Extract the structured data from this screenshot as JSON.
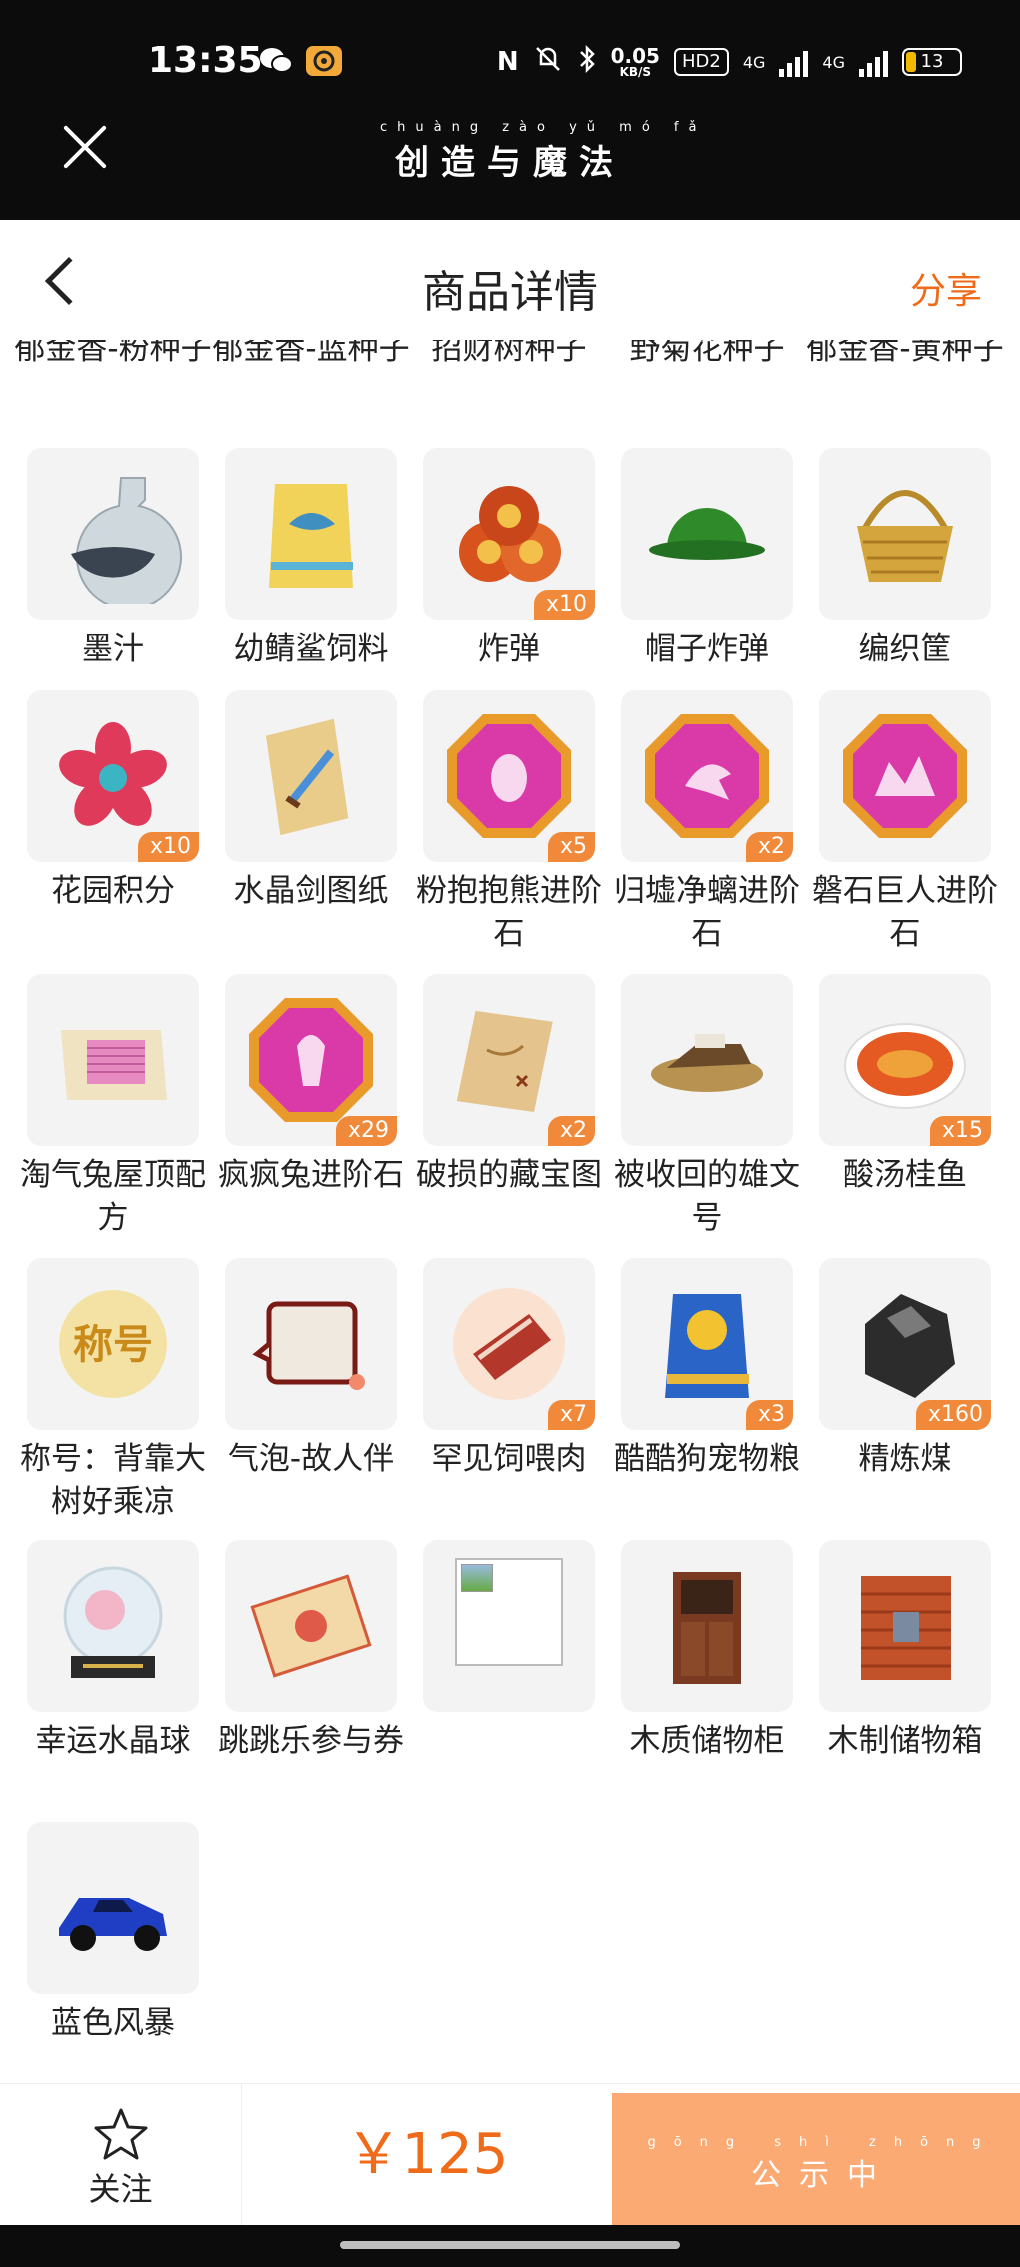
{
  "status_bar": {
    "time": "13:35",
    "speed_value": "0.05",
    "speed_unit": "KB/S",
    "hd": "HD2",
    "net1": "4G",
    "net2": "4G",
    "battery": "13"
  },
  "app": {
    "title": "创造与魔法",
    "title_pinyin": "chuàng zào yǔ mó fǎ"
  },
  "header": {
    "title": "商品详情",
    "share": "分享"
  },
  "items": [
    {
      "name": "郁金香-粉种子",
      "icon": "seed-icon"
    },
    {
      "name": "郁金香-蓝种子",
      "icon": "seed-icon"
    },
    {
      "name": "招财树种子",
      "icon": "seed-icon"
    },
    {
      "name": "野菊花种子",
      "icon": "seed-icon"
    },
    {
      "name": "郁金香-黄种子",
      "icon": "seed-icon"
    },
    {
      "name": "墨汁",
      "icon": "ink-bottle-icon"
    },
    {
      "name": "幼鲭鲨饲料",
      "icon": "feed-bag-icon"
    },
    {
      "name": "炸弹",
      "icon": "bomb-icon",
      "qty": "x10"
    },
    {
      "name": "帽子炸弹",
      "icon": "hat-bomb-icon"
    },
    {
      "name": "编织筐",
      "icon": "basket-icon"
    },
    {
      "name": "花园积分",
      "icon": "garden-points-icon",
      "qty": "x10"
    },
    {
      "name": "水晶剑图纸",
      "icon": "sword-scroll-icon"
    },
    {
      "name": "粉抱抱熊进阶石",
      "icon": "gem-egg-icon",
      "qty": "x5"
    },
    {
      "name": "归墟净螭进阶石",
      "icon": "gem-dragon-icon",
      "qty": "x2"
    },
    {
      "name": "磐石巨人进阶石",
      "icon": "gem-rock-icon"
    },
    {
      "name": "淘气兔屋顶配方",
      "icon": "roof-recipe-icon"
    },
    {
      "name": "疯疯兔进阶石",
      "icon": "gem-rabbit-icon",
      "qty": "x29"
    },
    {
      "name": "破损的藏宝图",
      "icon": "treasure-map-icon",
      "qty": "x2"
    },
    {
      "name": "被收回的雄文号",
      "icon": "shipwreck-icon"
    },
    {
      "name": "酸汤桂鱼",
      "icon": "fish-soup-icon",
      "qty": "x15"
    },
    {
      "name": "称号：背靠大树好乘凉",
      "icon": "title-badge-icon",
      "badge_text": "称号"
    },
    {
      "name": "气泡-故人伴",
      "icon": "chat-bubble-icon"
    },
    {
      "name": "罕见饲喂肉",
      "icon": "meat-icon",
      "qty": "x7"
    },
    {
      "name": "酷酷狗宠物粮",
      "icon": "pet-food-icon",
      "qty": "x3"
    },
    {
      "name": "精炼煤",
      "icon": "coal-icon",
      "qty": "x160"
    },
    {
      "name": "幸运水晶球",
      "icon": "crystal-ball-icon"
    },
    {
      "name": "跳跳乐参与券",
      "icon": "ticket-icon"
    },
    {
      "name": "",
      "icon": "broken-image-icon"
    },
    {
      "name": "木质储物柜",
      "icon": "cabinet-icon"
    },
    {
      "name": "木制储物箱",
      "icon": "wood-box-icon"
    },
    {
      "name": "蓝色风暴",
      "icon": "race-car-icon"
    }
  ],
  "bottom_bar": {
    "follow_label": "关注",
    "price": "￥125",
    "status_label": "公示中",
    "status_pinyin": "gōng shì zhōng"
  },
  "colors": {
    "accent": "#ef6b1a",
    "badge": "#f08a3a",
    "status_button": "#fbaa74",
    "tile_bg": "#f3f3f3"
  }
}
